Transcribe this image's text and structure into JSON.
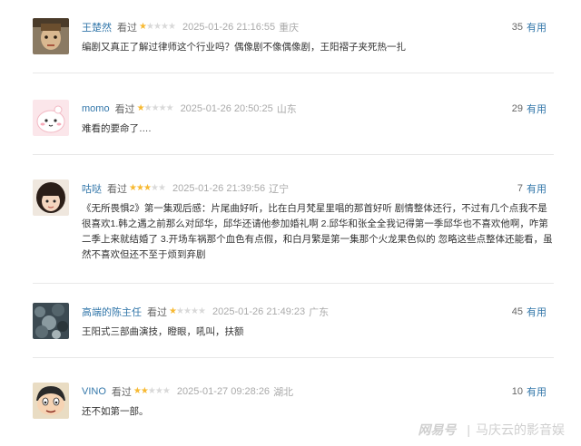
{
  "comments": [
    {
      "user": "王楚然",
      "action": "看过",
      "rating": 1,
      "time": "2025-01-26 21:16:55",
      "location": "重庆",
      "useful_count": "35",
      "useful_label": "有用",
      "content": "编剧又真正了解过律师这个行业吗？偶像剧不像偶像剧，王阳褶子夹死热一扎"
    },
    {
      "user": "momo",
      "action": "看过",
      "rating": 1,
      "time": "2025-01-26 20:50:25",
      "location": "山东",
      "useful_count": "29",
      "useful_label": "有用",
      "content": "难看的要命了…."
    },
    {
      "user": "咕哒",
      "action": "看过",
      "rating": 3,
      "time": "2025-01-26 21:39:56",
      "location": "辽宁",
      "useful_count": "7",
      "useful_label": "有用",
      "content": "《无所畏惧2》第一集观后感：片尾曲好听，比在白月梵星里唱的那首好听 剧情整体还行，不过有几个点我不是很喜欢1.韩之遇之前那么对邱华，邱华还请他参加婚礼啊 2.邱华和张全全我记得第一季邱华也不喜欢他啊，咋第二季上来就结婚了 3.开场车祸那个血色有点假，和白月繁是第一集那个火龙果色似的 忽略这些点整体还能看，虽然不喜欢但还不至于烦到弃剧"
    },
    {
      "user": "高端的陈主任",
      "action": "看过",
      "rating": 1,
      "time": "2025-01-26 21:49:23",
      "location": "广东",
      "useful_count": "45",
      "useful_label": "有用",
      "content": "王阳式三部曲演技，瞪眼，吼叫，扶额"
    },
    {
      "user": "VINO",
      "action": "看过",
      "rating": 2,
      "time": "2025-01-27 09:28:26",
      "location": "湖北",
      "useful_count": "10",
      "useful_label": "有用",
      "content": "还不如第一部。"
    }
  ],
  "watermark": {
    "logo": "网易号",
    "separator": "|",
    "account": "马庆云的影音娱"
  },
  "colors": {
    "username": "#3377aa",
    "star_on": "#f7b932",
    "star_off": "#d9d9d9",
    "meta_gray": "#aaaaaa"
  }
}
